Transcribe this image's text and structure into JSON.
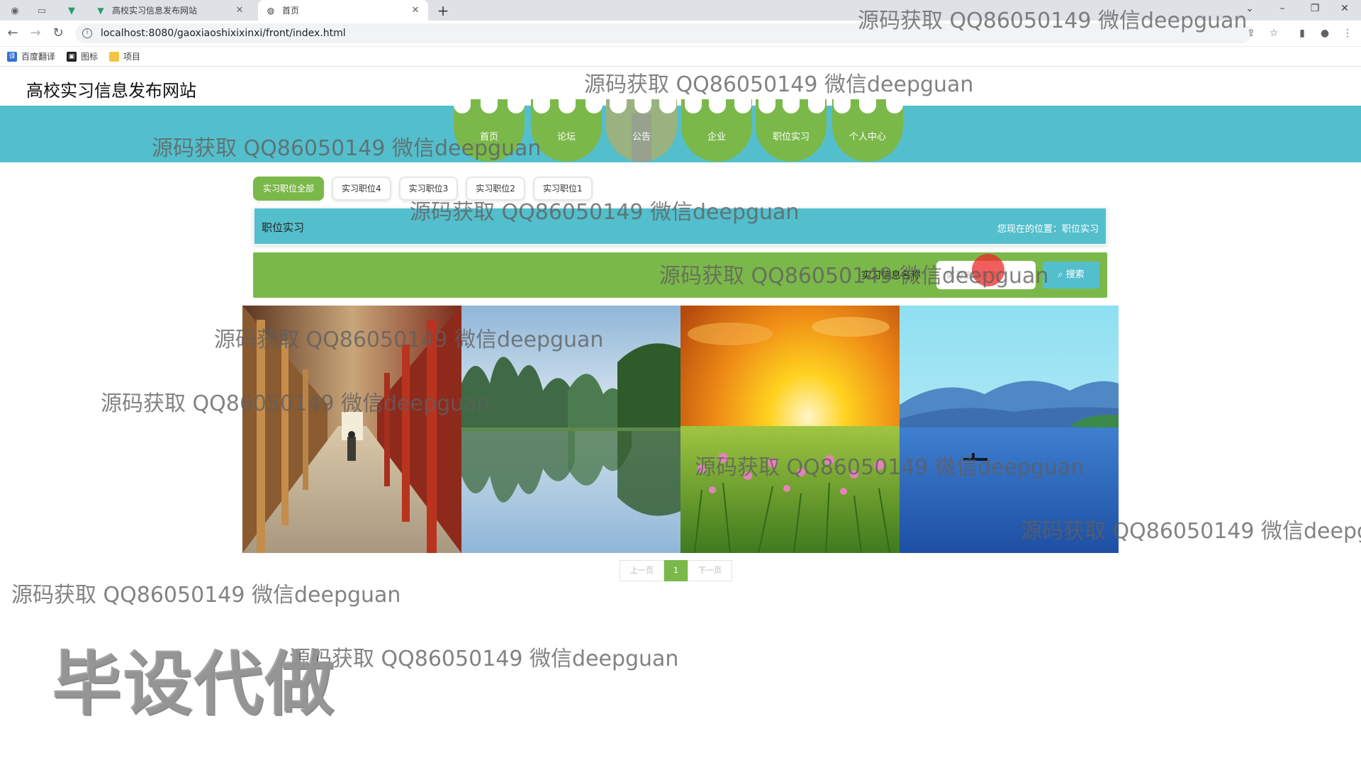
{
  "browser": {
    "tabs": [
      {
        "title": "高校实习信息发布网站",
        "favicon": "vue-logo-icon"
      },
      {
        "title": "首页",
        "favicon": "globe-icon"
      }
    ],
    "url": "localhost:8080/gaoxiaoshixixinxi/front/index.html",
    "bookmarks": [
      "百度翻译",
      "图标",
      "项目"
    ]
  },
  "site": {
    "title": "高校实习信息发布网站",
    "nav": [
      "首页",
      "论坛",
      "公告",
      "企业",
      "职位实习",
      "个人中心"
    ]
  },
  "filters": [
    "实习职位全部",
    "实习职位4",
    "实习职位3",
    "实习职位2",
    "实习职位1"
  ],
  "breadcrumb": {
    "section": "职位实习",
    "location": "您现在的位置：职位实习"
  },
  "search": {
    "label": "实习信息名称",
    "placeholder": "实习信息名称",
    "button": "搜索"
  },
  "pager": {
    "prev": "上一页",
    "current": "1",
    "next": "下一页"
  },
  "watermark": {
    "text": "源码获取 QQ86050149 微信deepguan",
    "stamp": "毕设代做"
  },
  "colors": {
    "teal": "#54bfcc",
    "green": "#7bb84a"
  }
}
